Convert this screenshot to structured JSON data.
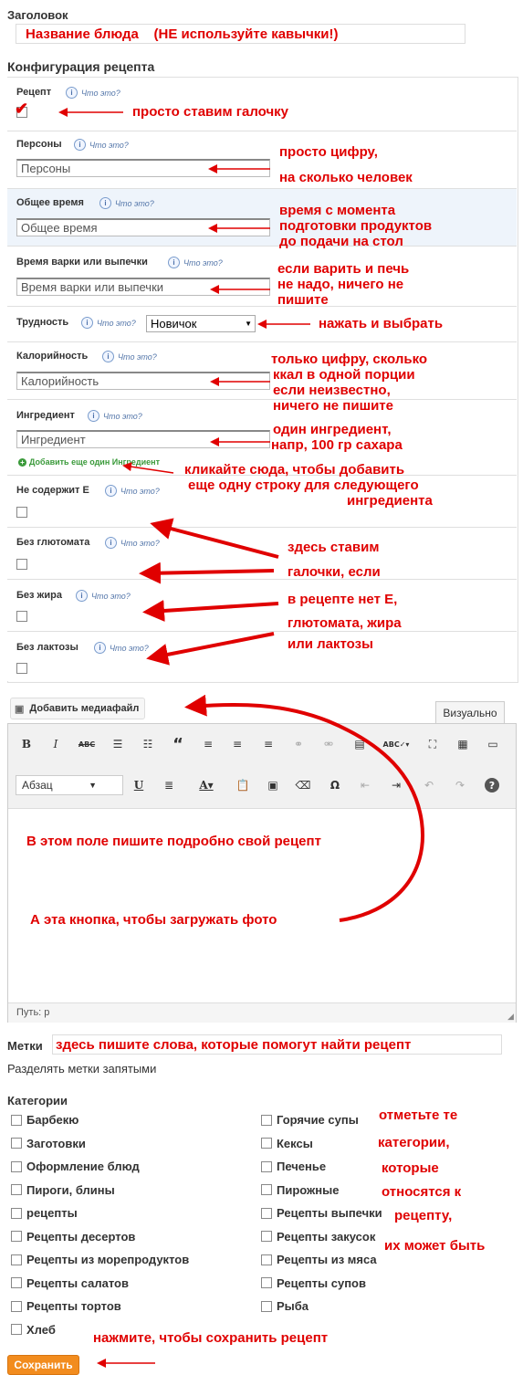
{
  "title_section": {
    "label": "Заголовок",
    "value": "Название блюда    (НЕ используйте кавычки!)"
  },
  "config": {
    "heading": "Конфигурация рецепта",
    "help_text": "Что это?",
    "recipe": {
      "label": "Рецепт",
      "checked": true
    },
    "persons": {
      "label": "Персоны",
      "placeholder": "Персоны"
    },
    "total_time": {
      "label": "Общее время",
      "placeholder": "Общее время"
    },
    "cook_time": {
      "label": "Время варки или выпечки",
      "placeholder": "Время варки или выпечки"
    },
    "difficulty": {
      "label": "Трудность",
      "value": "Новичок"
    },
    "calories": {
      "label": "Калорийность",
      "placeholder": "Калорийность"
    },
    "ingredient": {
      "label": "Ингредиент",
      "placeholder": "Ингредиент",
      "add_link": "Добавить еще один Ингредиент"
    },
    "no_e": {
      "label": "Не содержит Е"
    },
    "no_glutamate": {
      "label": "Без глютомата"
    },
    "no_fat": {
      "label": "Без жира"
    },
    "no_lactose": {
      "label": "Без лактозы"
    }
  },
  "editor": {
    "add_media": "Добавить медиафайл",
    "tab_visual": "Визуально",
    "format_select": "Абзац",
    "path": "Путь: p"
  },
  "tags": {
    "label": "Метки",
    "value": "здесь пишите слова, которые помогут найти рецепт",
    "hint": "Разделять метки запятыми"
  },
  "categories": {
    "heading": "Категории",
    "left": [
      "Барбекю",
      "Заготовки",
      "Оформление блюд",
      "Пироги, блины",
      "рецепты",
      "Рецепты десертов",
      "Рецепты из морепродуктов",
      "Рецепты салатов",
      "Рецепты тортов",
      "Хлеб"
    ],
    "right": [
      "Горячие супы",
      "Кексы",
      "Печенье",
      "Пирожные",
      "Рецепты выпечки",
      "Рецепты закусок",
      "Рецепты из мяса",
      "Рецепты супов",
      "Рыба"
    ]
  },
  "save_button": "Сохранить",
  "annotations": {
    "recipe": "просто ставим галочку",
    "persons_1": "просто цифру,",
    "persons_2": "на сколько человек",
    "time_1": "время с момента",
    "time_2": "подготовки продуктов",
    "time_3": "до подачи на стол",
    "cook_1": "если варить и печь",
    "cook_2": "не надо, ничего не",
    "cook_3": "пишите",
    "difficulty": "нажать и выбрать",
    "cal_1": "только цифру, сколько",
    "cal_2": "ккал в одной порции",
    "cal_3": "если неизвестно,",
    "cal_4": "ничего не пишите",
    "ing_1": "один ингредиент,",
    "ing_2": "напр, 100 гр сахара",
    "add_1": "кликайте сюда, чтобы добавить",
    "add_2": "еще одну строку для следующего",
    "add_3": "ингредиента",
    "checks_1": "здесь ставим",
    "checks_2": "галочки, если",
    "checks_3": "в рецепте нет Е,",
    "checks_4": "глютомата, жира",
    "checks_5": "или лактозы",
    "editor_1": "В этом поле пишите подробно свой рецепт",
    "editor_2": "А эта кнопка, чтобы загружать фото",
    "cats_1": "отметьте те",
    "cats_2": "категории,",
    "cats_3": "которые",
    "cats_4": "относятся к",
    "cats_5": "рецепту,",
    "cats_6": "их может быть",
    "save": "нажмите, чтобы сохранить рецепт"
  },
  "colors": {
    "annotation": "#e00000",
    "save_button": "#f28c1e",
    "add_link": "#3a9a3a"
  }
}
